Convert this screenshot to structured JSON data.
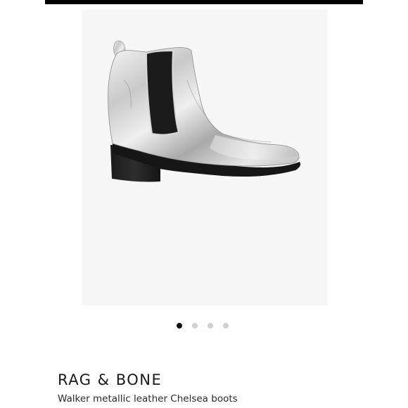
{
  "product": {
    "brand": "RAG & BONE",
    "name": "Walker metallic leather Chelsea boots"
  },
  "gallery": {
    "image_icon": "silver-chelsea-boot-image",
    "total_images": 4,
    "active_index": 0
  },
  "colors": {
    "top_bar": "#000000",
    "image_background": "#f6f6f6",
    "active_dot": "#111111",
    "inactive_dot": "#d0d0d0"
  }
}
